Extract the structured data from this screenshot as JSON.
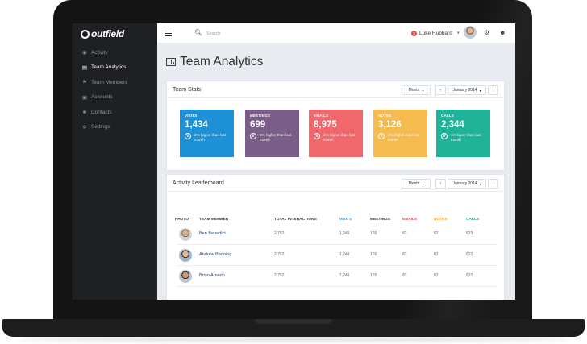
{
  "app": {
    "logo": "outfield"
  },
  "sidebar": {
    "items": [
      {
        "label": "Activity",
        "icon": "activity-icon",
        "glyph": "◉",
        "active": false
      },
      {
        "label": "Team Analytics",
        "icon": "chart-icon",
        "glyph": "▤",
        "active": true
      },
      {
        "label": "Team Members",
        "icon": "flag-icon",
        "glyph": "⚑",
        "active": false
      },
      {
        "label": "Accounts",
        "icon": "briefcase-icon",
        "glyph": "▣",
        "active": false
      },
      {
        "label": "Contacts",
        "icon": "users-icon",
        "glyph": "☻",
        "active": false
      },
      {
        "label": "Settings",
        "icon": "gear-icon",
        "glyph": "✲",
        "active": false
      }
    ]
  },
  "topbar": {
    "search_placeholder": "Search",
    "user": {
      "badge": "3",
      "name": "Luke Hubbard",
      "caret": "▾"
    }
  },
  "page": {
    "title": "Team Analytics"
  },
  "team_stats": {
    "title": "Team Stats",
    "period": "Month",
    "date": "January 2014",
    "prev": "‹",
    "next": "›",
    "caret": "▾",
    "cards": [
      {
        "label": "VISITS",
        "icon": "map-pin-icon",
        "value": "1,434",
        "note": "2% higher than last month",
        "color": "#1e90d6",
        "arrow": "⬆"
      },
      {
        "label": "MEETINGS",
        "icon": "briefcase-icon",
        "value": "699",
        "note": "5% higher than last month",
        "color": "#7b5e87",
        "arrow": "⬆"
      },
      {
        "label": "EMAILS",
        "icon": "envelope-icon",
        "value": "8,975",
        "note": "4% higher than last month",
        "color": "#f0686c",
        "arrow": "⬆"
      },
      {
        "label": "NOTES",
        "icon": "pencil-icon",
        "value": "3,126",
        "note": "2% higher than last month",
        "color": "#f6bb4f",
        "arrow": "⬆"
      },
      {
        "label": "CALLS",
        "icon": "phone-icon",
        "value": "2,344",
        "note": "1% lower than last month",
        "color": "#1fb39a",
        "arrow": "⬇"
      }
    ]
  },
  "leaderboard": {
    "title": "Activity Leaderboard",
    "period": "Month",
    "date": "January 2014",
    "prev": "‹",
    "next": "›",
    "caret": "▾",
    "columns": [
      {
        "label": "PHOTO",
        "color": "#333333"
      },
      {
        "label": "TEAM MEMBER",
        "color": "#333333"
      },
      {
        "label": "TOTAL INTERACTIONS",
        "color": "#333333"
      },
      {
        "label": "VISITS",
        "color": "#1e90d6"
      },
      {
        "label": "MEETINGS",
        "color": "#333333"
      },
      {
        "label": "EMAILS",
        "color": "#e84a4f"
      },
      {
        "label": "NOTES",
        "color": "#f2a62a"
      },
      {
        "label": "CALLS",
        "color": "#1fa37e"
      }
    ],
    "rows": [
      {
        "name": "Ben Benedict",
        "total": "2,752",
        "visits": "1,241",
        "meetings": "165",
        "emails": "82",
        "notes": "82",
        "calls": "823"
      },
      {
        "name": "Andrew Benning",
        "total": "2,752",
        "visits": "1,241",
        "meetings": "165",
        "emails": "82",
        "notes": "82",
        "calls": "823"
      },
      {
        "name": "Brian Arnedo",
        "total": "2,752",
        "visits": "1,241",
        "meetings": "165",
        "emails": "82",
        "notes": "82",
        "calls": "823"
      }
    ]
  },
  "colors": {
    "sidebar_bg": "#1f2024",
    "accent": "#1e90d6"
  }
}
